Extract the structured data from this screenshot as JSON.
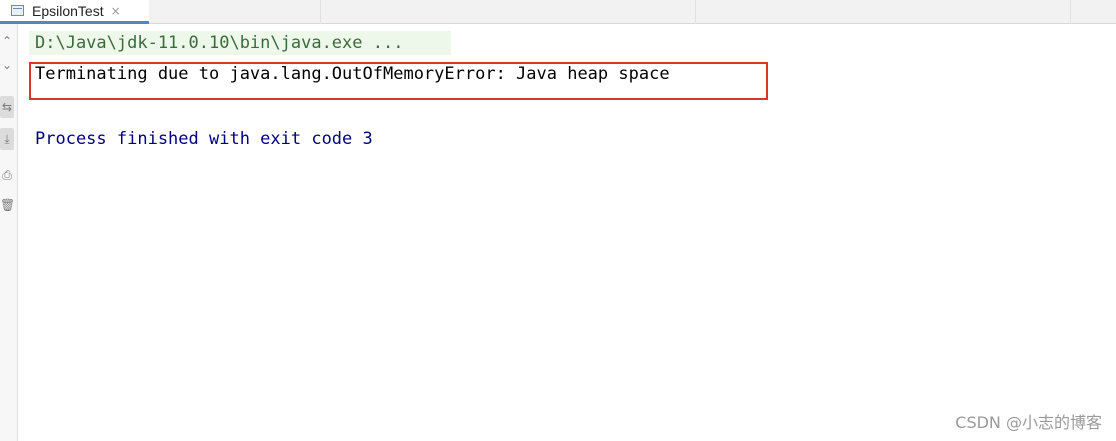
{
  "tab": {
    "title": "EpsilonTest",
    "close_glyph": "×"
  },
  "gutter": {
    "buttons": [
      {
        "icon": "arrow-up-icon",
        "glyph": "⌃"
      },
      {
        "icon": "arrow-down-icon",
        "glyph": "⌄"
      },
      {
        "icon": "soft-wrap-icon",
        "glyph": "⇆"
      },
      {
        "icon": "scroll-to-end-icon",
        "glyph": "⤓"
      },
      {
        "icon": "print-icon",
        "glyph": "⎙"
      },
      {
        "icon": "trash-icon",
        "glyph": "🗑"
      }
    ]
  },
  "console": {
    "command": "D:\\Java\\jdk-11.0.10\\bin\\java.exe ...",
    "error": "Terminating due to java.lang.OutOfMemoryError: Java heap space",
    "finished": "Process finished with exit code 3"
  },
  "watermark": "CSDN @小志的博客",
  "colors": {
    "highlight_border": "#e03131",
    "command_text": "#3b6b3b",
    "finished_text": "#000080",
    "tab_accent": "#4a88c7"
  }
}
